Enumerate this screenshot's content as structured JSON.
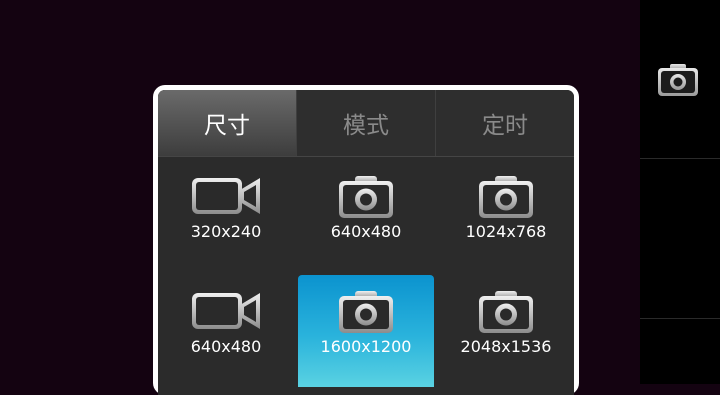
{
  "tabs": [
    {
      "label": "尺寸",
      "active": true
    },
    {
      "label": "模式",
      "active": false
    },
    {
      "label": "定时",
      "active": false
    }
  ],
  "sizes": [
    {
      "label": "320x240",
      "icon": "video-camera-icon",
      "selected": false
    },
    {
      "label": "640x480",
      "icon": "camera-icon",
      "selected": false
    },
    {
      "label": "1024x768",
      "icon": "camera-icon",
      "selected": false
    },
    {
      "label": "640x480",
      "icon": "video-camera-icon",
      "selected": false
    },
    {
      "label": "1600x1200",
      "icon": "camera-icon",
      "selected": true
    },
    {
      "label": "2048x1536",
      "icon": "camera-icon",
      "selected": false
    }
  ],
  "sidebar": {
    "shutter_icon": "camera-icon"
  },
  "colors": {
    "background": "#140311",
    "selected": "#1aa8d8",
    "panel": "#2b2b2b"
  }
}
